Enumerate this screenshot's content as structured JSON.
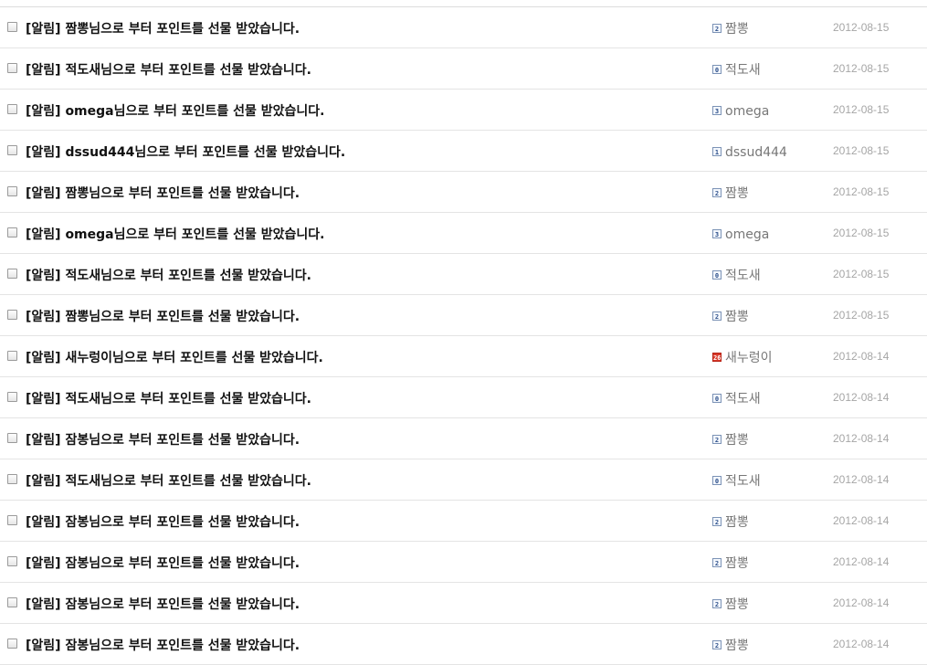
{
  "rows": [
    {
      "prefix": "[알림] ",
      "nick": "짬뽕",
      "suffix": "님으로 부터 포인트를 선물 받았습니다.",
      "level": "2",
      "level_red": false,
      "author": "짬뽕",
      "date": "2012-08-15"
    },
    {
      "prefix": "[알림] ",
      "nick": "적도새",
      "suffix": "님으로 부터 포인트를 선물 받았습니다.",
      "level": "0",
      "level_red": false,
      "author": "적도새",
      "date": "2012-08-15"
    },
    {
      "prefix": "[알림] ",
      "nick": "omega",
      "suffix": "님으로 부터 포인트를 선물 받았습니다.",
      "level": "3",
      "level_red": false,
      "author": "omega",
      "date": "2012-08-15"
    },
    {
      "prefix": "[알림] ",
      "nick": "dssud444",
      "suffix": "님으로 부터 포인트를 선물 받았습니다.",
      "level": "1",
      "level_red": false,
      "author": "dssud444",
      "date": "2012-08-15"
    },
    {
      "prefix": "[알림] ",
      "nick": "짬뽕",
      "suffix": "님으로 부터 포인트를 선물 받았습니다.",
      "level": "2",
      "level_red": false,
      "author": "짬뽕",
      "date": "2012-08-15"
    },
    {
      "prefix": "[알림] ",
      "nick": "omega",
      "suffix": "님으로 부터 포인트를 선물 받았습니다.",
      "level": "3",
      "level_red": false,
      "author": "omega",
      "date": "2012-08-15"
    },
    {
      "prefix": "[알림] ",
      "nick": "적도새",
      "suffix": "님으로 부터 포인트를 선물 받았습니다.",
      "level": "0",
      "level_red": false,
      "author": "적도새",
      "date": "2012-08-15"
    },
    {
      "prefix": "[알림] ",
      "nick": "짬뽕",
      "suffix": "님으로 부터 포인트를 선물 받았습니다.",
      "level": "2",
      "level_red": false,
      "author": "짬뽕",
      "date": "2012-08-15"
    },
    {
      "prefix": "[알림] ",
      "nick": "새누렁이",
      "suffix": "님으로 부터 포인트를 선물 받았습니다.",
      "level": "26",
      "level_red": true,
      "author": "새누렁이",
      "date": "2012-08-14"
    },
    {
      "prefix": "[알림] ",
      "nick": "적도새",
      "suffix": "님으로 부터 포인트를 선물 받았습니다.",
      "level": "0",
      "level_red": false,
      "author": "적도새",
      "date": "2012-08-14"
    },
    {
      "prefix": "[알림] ",
      "nick": "잠봉",
      "suffix": "님으로 부터 포인트를 선물 받았습니다.",
      "level": "2",
      "level_red": false,
      "author": "짬뽕",
      "date": "2012-08-14"
    },
    {
      "prefix": "[알림] ",
      "nick": "적도새",
      "suffix": "님으로 부터 포인트를 선물 받았습니다.",
      "level": "0",
      "level_red": false,
      "author": "적도새",
      "date": "2012-08-14"
    },
    {
      "prefix": "[알림] ",
      "nick": "잠봉",
      "suffix": "님으로 부터 포인트를 선물 받았습니다.",
      "level": "2",
      "level_red": false,
      "author": "짬뽕",
      "date": "2012-08-14"
    },
    {
      "prefix": "[알림] ",
      "nick": "잠봉",
      "suffix": "님으로 부터 포인트를 선물 받았습니다.",
      "level": "2",
      "level_red": false,
      "author": "짬뽕",
      "date": "2012-08-14"
    },
    {
      "prefix": "[알림] ",
      "nick": "잠봉",
      "suffix": "님으로 부터 포인트를 선물 받았습니다.",
      "level": "2",
      "level_red": false,
      "author": "짬뽕",
      "date": "2012-08-14"
    },
    {
      "prefix": "[알림] ",
      "nick": "잠봉",
      "suffix": "님으로 부터 포인트를 선물 받았습니다.",
      "level": "2",
      "level_red": false,
      "author": "짬뽕",
      "date": "2012-08-14"
    }
  ]
}
